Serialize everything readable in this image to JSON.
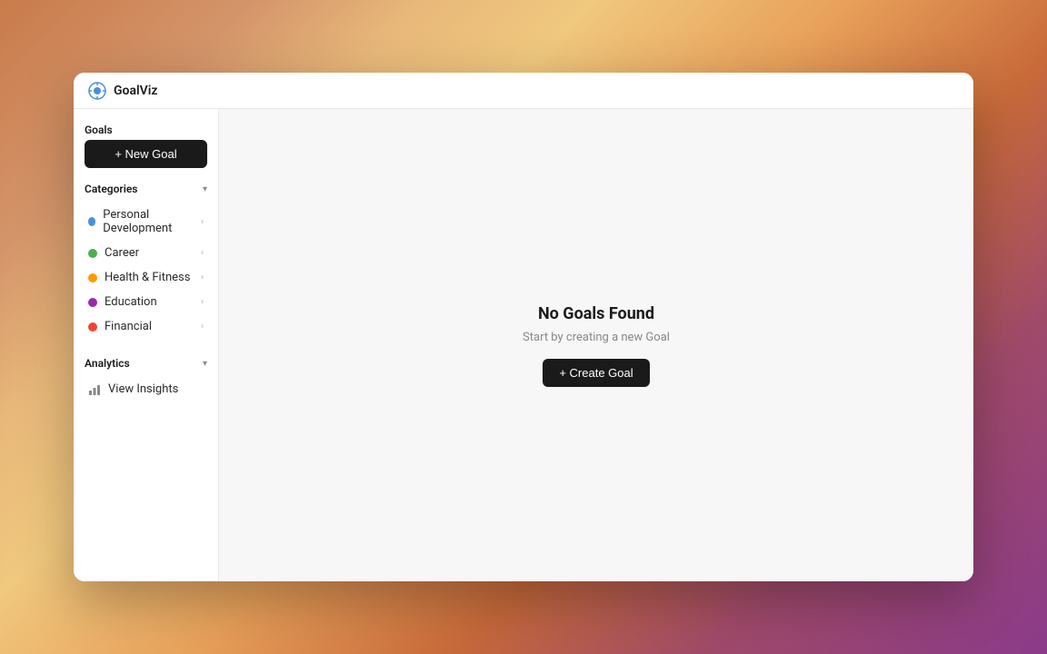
{
  "app": {
    "name": "GoalViz",
    "logo_color": "#4a90d9"
  },
  "sidebar": {
    "goals_label": "Goals",
    "new_goal_button": "+ New Goal",
    "categories": {
      "label": "Categories",
      "items": [
        {
          "name": "Personal Development",
          "color": "#4a90d9",
          "id": "personal-development"
        },
        {
          "name": "Career",
          "color": "#4CAF50",
          "id": "career"
        },
        {
          "name": "Health & Fitness",
          "color": "#FF9800",
          "id": "health-fitness"
        },
        {
          "name": "Education",
          "color": "#9C27B0",
          "id": "education"
        },
        {
          "name": "Financial",
          "color": "#f44336",
          "id": "financial"
        }
      ]
    },
    "analytics": {
      "label": "Analytics",
      "view_insights_label": "View Insights"
    }
  },
  "main": {
    "empty_state": {
      "title": "No Goals Found",
      "subtitle": "Start by creating a new Goal",
      "create_button": "+ Create Goal"
    }
  }
}
